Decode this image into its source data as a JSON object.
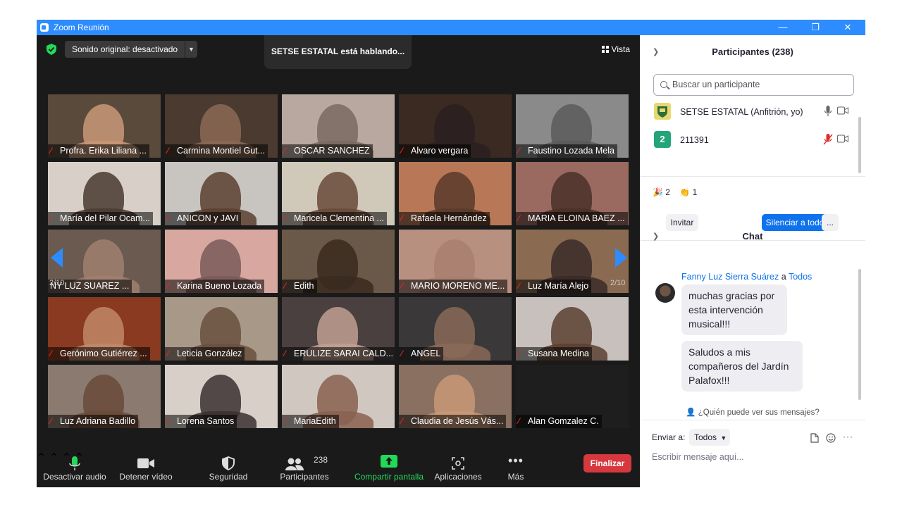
{
  "window": {
    "title": "Zoom Reunión",
    "controls": [
      "—",
      "❐",
      "✕"
    ]
  },
  "top_bar": {
    "sound_label": "Sonido original: desactivado",
    "speaking": "SETSE ESTATAL está hablando...",
    "view_label": "Vista"
  },
  "gallery": {
    "page_left": "2/10",
    "page_right": "2/10",
    "tiles": [
      {
        "name": "Profra. Erika Liliana ...",
        "bg": "#5a4a3c",
        "fg": "#c89878",
        "muted": true
      },
      {
        "name": "Carmina  Montiel Gut...",
        "bg": "#4a3a30",
        "fg": "#8a6a55",
        "muted": true
      },
      {
        "name": "OSCAR SANCHEZ",
        "bg": "#b8a8a0",
        "fg": "#7a6a60",
        "muted": true
      },
      {
        "name": "Alvaro vergara",
        "bg": "#3a2a22",
        "fg": "#2a2020",
        "muted": true
      },
      {
        "name": "Faustino Lozada Mela",
        "bg": "#8a8a8a",
        "fg": "#5a5a5a",
        "muted": true
      },
      {
        "name": "María del Pilar Ocam...",
        "bg": "#d8d0c8",
        "fg": "#4a3a30",
        "muted": true
      },
      {
        "name": "ANICON y JAVI",
        "bg": "#c8c4c0",
        "fg": "#5a4030",
        "muted": true
      },
      {
        "name": "Maricela Clementina ...",
        "bg": "#d0c8b8",
        "fg": "#6a4a38",
        "muted": true
      },
      {
        "name": "Rafaela Hernández",
        "bg": "#b87858",
        "fg": "#5a3a2a",
        "muted": true
      },
      {
        "name": "MARIA ELOINA BAEZ ...",
        "bg": "#9a6a60",
        "fg": "#4a3028",
        "muted": true
      },
      {
        "name": "NY LUZ SUAREZ ...",
        "bg": "#6a5a50",
        "fg": "#a08070",
        "muted": false
      },
      {
        "name": "Karina Bueno Lozada",
        "bg": "#d8a8a0",
        "fg": "#7a5a58",
        "muted": true
      },
      {
        "name": "Edith",
        "bg": "#6a5848",
        "fg": "#3a2a20",
        "muted": true
      },
      {
        "name": "MARIO MORENO ME...",
        "bg": "#b89080",
        "fg": "#a88070",
        "muted": true
      },
      {
        "name": "Luz María Alejo",
        "bg": "#8a6a50",
        "fg": "#3a2a28",
        "muted": true
      },
      {
        "name": "Gerónimo Gutiérrez ...",
        "bg": "#8a3a20",
        "fg": "#c08868",
        "muted": true
      },
      {
        "name": "Leticia González",
        "bg": "#a89888",
        "fg": "#6a5040",
        "muted": true
      },
      {
        "name": "ERULIZE SARAI CALD...",
        "bg": "#4a4040",
        "fg": "#c0a090",
        "muted": true
      },
      {
        "name": "ANGEL",
        "bg": "#3a3838",
        "fg": "#8a6a58",
        "muted": true
      },
      {
        "name": "Susana Medina",
        "bg": "#c8c0bc",
        "fg": "#5a4030",
        "muted": true
      },
      {
        "name": "Luz Adriana Badillo",
        "bg": "#8a7a70",
        "fg": "#6a4a38",
        "muted": true
      },
      {
        "name": "Lorena Santos",
        "bg": "#d8d0c8",
        "fg": "#3a3030",
        "muted": true
      },
      {
        "name": "MariaEdith",
        "bg": "#d0c8c0",
        "fg": "#8a6050",
        "muted": true
      },
      {
        "name": "Claudia de Jesús Vás...",
        "bg": "#8a7060",
        "fg": "#c89878",
        "muted": true
      },
      {
        "name": "Alan Gomzalez C.",
        "bg": "#1e1e1e",
        "fg": "#1e1e1e",
        "muted": true
      }
    ]
  },
  "toolbar": {
    "audio": "Desactivar audio",
    "video": "Detener vídeo",
    "security": "Seguridad",
    "participants": "Participantes",
    "participants_count": "238",
    "share": "Compartir pantalla",
    "apps": "Aplicaciones",
    "more": "Más",
    "end": "Finalizar"
  },
  "participants_panel": {
    "title": "Participantes (238)",
    "search_placeholder": "Buscar un participante",
    "rows": [
      {
        "name": "SETSE ESTATAL (Anfitrión, yo)",
        "avatar_color": "#e8d870"
      },
      {
        "name": "211391",
        "avatar_label": "2",
        "avatar_color": "#23a57a"
      }
    ],
    "reaction_1_count": "2",
    "reaction_2_count": "1",
    "invite": "Invitar",
    "mute_all": "Silenciar a todos",
    "more": "..."
  },
  "chat": {
    "title": "Chat",
    "sender": "Fanny Luz Sierra Suárez",
    "connector": "a",
    "recipient": "Todos",
    "messages": [
      "muchas gracias por esta intervención musical!!!",
      "Saludos a mis compañeros del Jardín Palafox!!!"
    ],
    "who_can_see": "¿Quién puede ver sus mensajes?",
    "send_to_label": "Enviar a:",
    "send_to_value": "Todos",
    "compose_placeholder": "Escribir mensaje aquí..."
  }
}
